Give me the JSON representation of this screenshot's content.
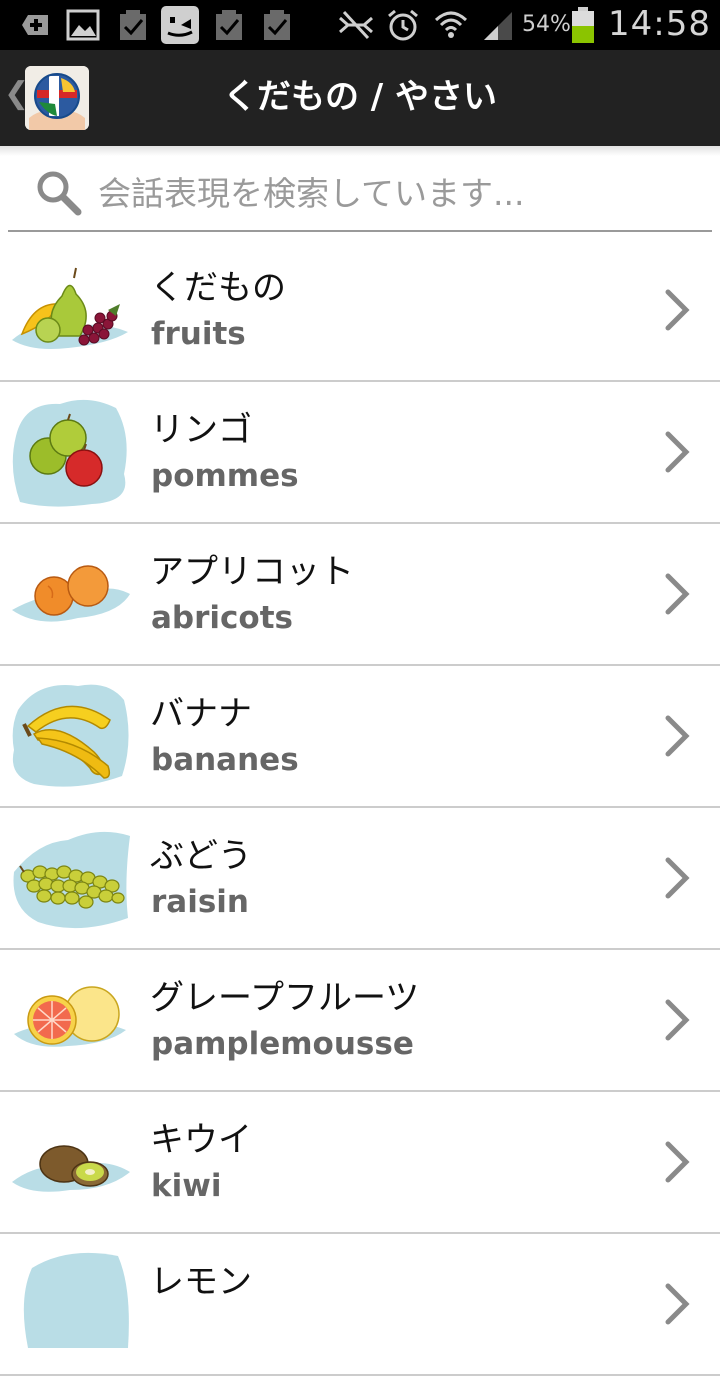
{
  "status_bar": {
    "battery_percent": "54%",
    "time": "14:58",
    "icons": [
      "add-icon",
      "gallery-icon",
      "check-icon",
      "messenger-icon",
      "check-icon",
      "check-icon",
      "mute-icon",
      "alarm-icon",
      "wifi-icon",
      "signal-icon",
      "battery-icon"
    ]
  },
  "action_bar": {
    "back_glyph": "❮",
    "title": "くだもの / やさい",
    "logo": "globe-logo"
  },
  "search": {
    "placeholder": "会話表現を検索しています..."
  },
  "items": [
    {
      "title": "くだもの",
      "subtitle": "fruits",
      "icon": "fruits-illustration"
    },
    {
      "title": "リンゴ",
      "subtitle": "pommes",
      "icon": "apples-illustration"
    },
    {
      "title": "アプリコット",
      "subtitle": "abricots",
      "icon": "apricots-illustration"
    },
    {
      "title": "バナナ",
      "subtitle": "bananes",
      "icon": "bananas-illustration"
    },
    {
      "title": "ぶどう",
      "subtitle": "raisin",
      "icon": "grapes-illustration"
    },
    {
      "title": "グレープフルーツ",
      "subtitle": "pamplemousse",
      "icon": "grapefruit-illustration"
    },
    {
      "title": "キウイ",
      "subtitle": "kiwi",
      "icon": "kiwi-illustration"
    },
    {
      "title": "レモン",
      "subtitle": "",
      "icon": "lemon-illustration"
    }
  ],
  "colors": {
    "action_bar": "#222222",
    "status_bar": "#000000",
    "divider": "#cccccc",
    "subtitle": "#666666",
    "chevron": "#8a8a8a",
    "splash": "#b9dde6"
  }
}
